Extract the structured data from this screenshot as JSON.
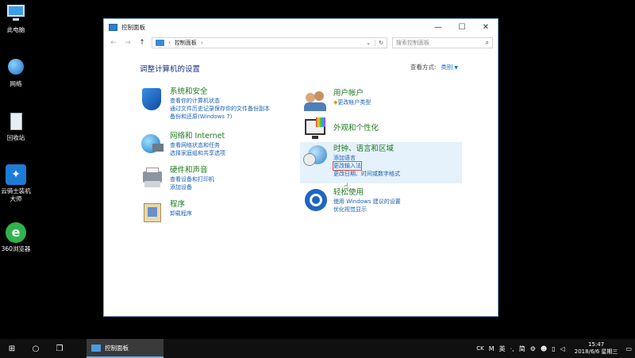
{
  "desktop": {
    "icons": [
      {
        "label": "此电脑"
      },
      {
        "label": "网络"
      },
      {
        "label": "回收站"
      },
      {
        "label": "云骑士装机\n大师"
      },
      {
        "label": "360浏览器"
      }
    ]
  },
  "window": {
    "title": "控制面板",
    "controls": {
      "minimize": "—",
      "maximize": "☐",
      "close": "✕"
    },
    "address": {
      "path": "控制面板",
      "separator": "›"
    },
    "search": {
      "placeholder": "搜索控制面板"
    },
    "heading": "调整计算机的设置",
    "viewby": {
      "label": "查看方式:",
      "value": "类别"
    },
    "categories": {
      "system": {
        "title": "系统和安全",
        "links": [
          "查看你的计算机状态",
          "通过文件历史记录保存你的文件备份副本",
          "备份和还原(Windows 7)"
        ]
      },
      "network": {
        "title": "网络和 Internet",
        "links": [
          "查看网络状态和任务",
          "选择家庭组和共享选项"
        ]
      },
      "hardware": {
        "title": "硬件和声音",
        "links": [
          "查看设备和打印机",
          "添加设备"
        ]
      },
      "programs": {
        "title": "程序",
        "links": [
          "卸载程序"
        ]
      },
      "users": {
        "title": "用户帐户",
        "links": [
          "更改帐户类型"
        ]
      },
      "appearance": {
        "title": "外观和个性化",
        "links": []
      },
      "clock": {
        "title": "时钟、语言和区域",
        "links": [
          "添加语言",
          "更改输入法",
          "更改日期、时间或数字格式"
        ]
      },
      "ease": {
        "title": "轻松使用",
        "links": [
          "使用 Windows 建议的设置",
          "优化视觉显示"
        ]
      }
    }
  },
  "taskbar": {
    "app_label": "控制面板",
    "tray": {
      "items": [
        "CK",
        "M",
        "英",
        "·,",
        "简",
        "⚙"
      ]
    },
    "clock": {
      "time": "15:47",
      "date": "2018/6/6 星期三"
    }
  },
  "colors": {
    "link": "#1a5fb4",
    "category_title": "#1e7a1e",
    "hover_bg": "#e5f1fb",
    "heading": "#1e3287"
  }
}
